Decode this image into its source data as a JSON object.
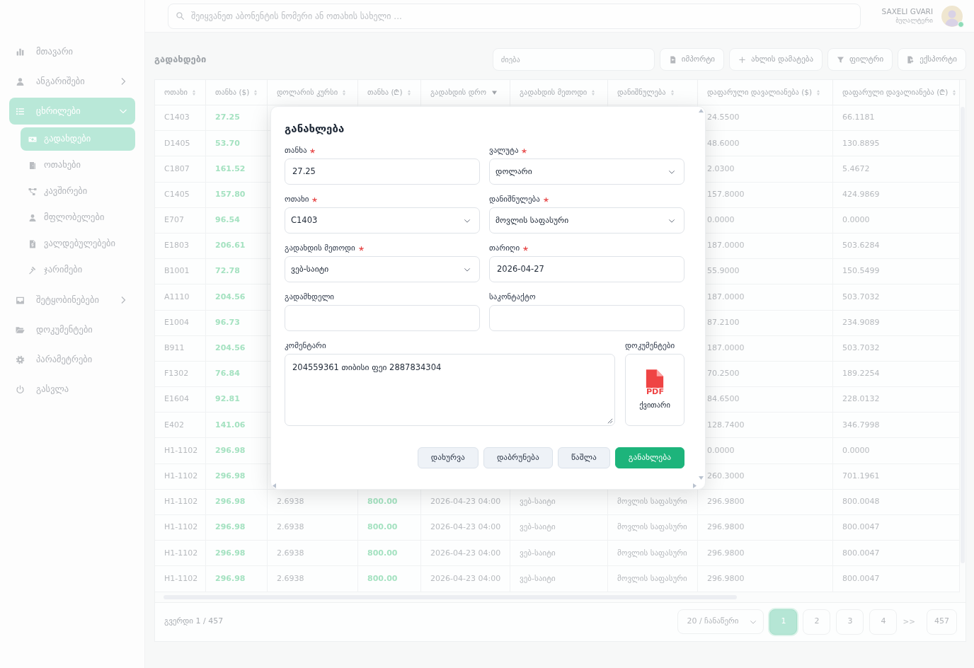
{
  "search": {
    "placeholder": "შეიყვანეთ აბონენტის ნომერი ან ოთახის სახელი ..."
  },
  "user": {
    "name": "SAXELI GVARI",
    "role": "ბუღალტერი",
    "online": true
  },
  "sidebar": {
    "items": [
      {
        "label": "მთავარი",
        "selected": false
      },
      {
        "label": "ანგარიშები",
        "selected": false,
        "expanded": false
      },
      {
        "label": "ცხრილები",
        "selected": true,
        "expanded": true,
        "children": [
          {
            "label": "გადახდები",
            "selected": true
          },
          {
            "label": "ოთახები",
            "selected": false
          },
          {
            "label": "კავშირები",
            "selected": false
          },
          {
            "label": "მფლობელები",
            "selected": false
          },
          {
            "label": "ვალდებულებები",
            "selected": false
          },
          {
            "label": "ჯარიმები",
            "selected": false
          }
        ]
      },
      {
        "label": "შეტყობინებები",
        "selected": false,
        "expanded": false
      },
      {
        "label": "დოკუმენტები",
        "selected": false
      },
      {
        "label": "პარამეტრები",
        "selected": false
      },
      {
        "label": "გასვლა",
        "selected": false
      }
    ]
  },
  "page": {
    "title": "გადახდები",
    "search": {
      "placeholder": "ძიება"
    },
    "buttons": [
      {
        "label": "იმპორტი"
      },
      {
        "label": "ახლის დამატება"
      },
      {
        "label": "ფილტრი"
      },
      {
        "label": "ექსპორტი"
      }
    ]
  },
  "table": {
    "columns": [
      {
        "label": "ოთახი",
        "kind": "plain",
        "sorted": false
      },
      {
        "label": "თანხა ($)",
        "kind": "amount",
        "sorted": false
      },
      {
        "label": "დოლარის კურსი",
        "kind": "plain",
        "sorted": false
      },
      {
        "label": "თანხა (₾)",
        "kind": "amount",
        "sorted": false
      },
      {
        "label": "გადახდის დრო",
        "kind": "plain",
        "sorted": true
      },
      {
        "label": "გადახდის მეთოდი",
        "kind": "plain",
        "sorted": false
      },
      {
        "label": "დანიშნულება",
        "kind": "plain",
        "sorted": false
      },
      {
        "label": "დაფარული დავალიანება ($)",
        "kind": "plain",
        "sorted": false
      },
      {
        "label": "დაფარული დავალიანება (₾)",
        "kind": "plain",
        "sorted": false
      }
    ],
    "rows": [
      {
        "room": "C1403",
        "amount_usd": "27.25",
        "paid_usd": "24.5500",
        "paid_gel": "66.1181"
      },
      {
        "room": "D1405",
        "amount_usd": "53.70",
        "paid_usd": "48.6000",
        "paid_gel": "130.8895"
      },
      {
        "room": "C1807",
        "amount_usd": "161.52",
        "paid_usd": "2.0300",
        "paid_gel": "5.4672"
      },
      {
        "room": "C1405",
        "amount_usd": "157.80",
        "paid_usd": "157.8000",
        "paid_gel": "424.9869"
      },
      {
        "room": "E707",
        "amount_usd": "96.54",
        "paid_usd": "0.0000",
        "paid_gel": "0.0000"
      },
      {
        "room": "E1803",
        "amount_usd": "206.61",
        "paid_usd": "187.0000",
        "paid_gel": "503.6284"
      },
      {
        "room": "B1001",
        "amount_usd": "72.78",
        "paid_usd": "55.9000",
        "paid_gel": "150.5499"
      },
      {
        "room": "A1110",
        "amount_usd": "204.56",
        "paid_usd": "187.0000",
        "paid_gel": "503.7032"
      },
      {
        "room": "E1004",
        "amount_usd": "96.73",
        "paid_usd": "87.2100",
        "paid_gel": "234.9089"
      },
      {
        "room": "B911",
        "amount_usd": "204.56",
        "paid_usd": "187.0000",
        "paid_gel": "503.7032"
      },
      {
        "room": "F1302",
        "amount_usd": "76.84",
        "paid_usd": "70.2500",
        "paid_gel": "189.2254"
      },
      {
        "room": "E1604",
        "amount_usd": "92.81",
        "paid_usd": "84.6500",
        "paid_gel": "228.0132"
      },
      {
        "room": "E402",
        "amount_usd": "141.06",
        "paid_usd": "128.7400",
        "paid_gel": "346.7998"
      },
      {
        "room": "H1-1102",
        "amount_usd": "296.98",
        "paid_usd": "0.0000",
        "paid_gel": "0.0000"
      },
      {
        "room": "H1-1102",
        "amount_usd": "296.98",
        "paid_usd": "260.3000",
        "paid_gel": "701.1961"
      },
      {
        "room": "H1-1102",
        "amount_usd": "296.98",
        "rate": "2.6938",
        "amount_gel": "800.00",
        "paid_at": "2026-04-23 04:00",
        "method": "ვებ-საიტი",
        "purpose": "მოვლის საფასური",
        "paid_usd": "296.9800",
        "paid_gel": "800.0048"
      },
      {
        "room": "H1-1102",
        "amount_usd": "296.98",
        "rate": "2.6938",
        "amount_gel": "800.00",
        "paid_at": "2026-04-23 04:00",
        "method": "ვებ-საიტი",
        "purpose": "მოვლის საფასური",
        "paid_usd": "296.9800",
        "paid_gel": "800.0047"
      },
      {
        "room": "H1-1102",
        "amount_usd": "296.98",
        "rate": "2.6938",
        "amount_gel": "800.00",
        "paid_at": "2026-04-23 04:00",
        "method": "ვებ-საიტი",
        "purpose": "მოვლის საფასური",
        "paid_usd": "296.9800",
        "paid_gel": "800.0047"
      },
      {
        "room": "H1-1102",
        "amount_usd": "296.98",
        "rate": "2.6938",
        "amount_gel": "800.00",
        "paid_at": "2026-04-23 04:00",
        "method": "ვებ-საიტი",
        "purpose": "მოვლის საფასური",
        "paid_usd": "296.9800",
        "paid_gel": "800.0047"
      }
    ]
  },
  "pagination": {
    "summary": "გვერდი 1 / 457",
    "page_size": "20 / ჩანაწერი",
    "pages": [
      {
        "label": "1",
        "kind": "page",
        "selected": true
      },
      {
        "label": "2",
        "kind": "page",
        "selected": false
      },
      {
        "label": "3",
        "kind": "page",
        "selected": false
      },
      {
        "label": "4",
        "kind": "page",
        "selected": false
      },
      {
        "label": ">>",
        "kind": "jump",
        "selected": false
      },
      {
        "label": "457",
        "kind": "page",
        "selected": false
      }
    ]
  },
  "modal": {
    "title": "განახლება",
    "fields": [
      {
        "label": "თანხა",
        "required": true,
        "kind": "input",
        "value": "27.25"
      },
      {
        "label": "ვალუტა",
        "required": true,
        "kind": "select",
        "value": "დოლარი"
      },
      {
        "label": "ოთახი",
        "required": true,
        "kind": "select",
        "value": "C1403"
      },
      {
        "label": "დანიშნულება",
        "required": true,
        "kind": "select",
        "value": "მოვლის საფასური"
      },
      {
        "label": "გადახდის მეთოდი",
        "required": true,
        "kind": "select",
        "value": "ვებ-საიტი"
      },
      {
        "label": "თარიღი",
        "required": true,
        "kind": "input",
        "value": "2026-04-27"
      },
      {
        "label": "გადამხდელი",
        "required": false,
        "kind": "input"
      },
      {
        "label": "საკონტაქტო",
        "required": false,
        "kind": "input"
      }
    ],
    "comment": {
      "label": "კომენტარი",
      "value": "204559361 თიბისი ფეი 2887834304"
    },
    "documents": {
      "label": "დოკუმენტები",
      "files": [
        {
          "name": "ქვითარი",
          "type": "PDF"
        }
      ]
    },
    "buttons": [
      {
        "label": "დახურვა",
        "kind": "secondary"
      },
      {
        "label": "დაბრუნება",
        "kind": "secondary"
      },
      {
        "label": "წაშლა",
        "kind": "secondary"
      },
      {
        "label": "განახლება",
        "kind": "primary"
      }
    ]
  }
}
